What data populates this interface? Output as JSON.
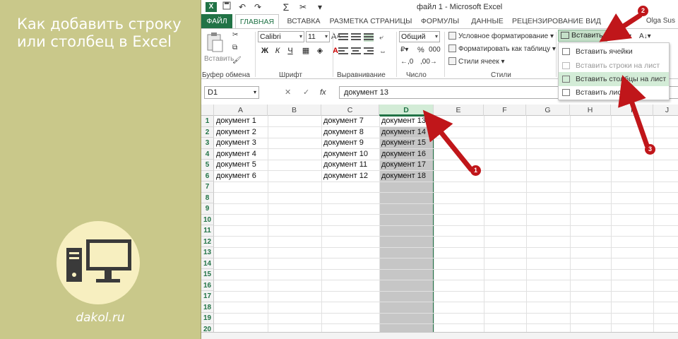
{
  "left_panel": {
    "title": "Как добавить строку или столбец в Excel",
    "site": "dakol.ru"
  },
  "window": {
    "title": "файл 1 - Microsoft Excel",
    "app_icon_letter": "X",
    "user": "Olga Sus"
  },
  "ribbon_tabs": [
    "ФАЙЛ",
    "ГЛАВНАЯ",
    "ВСТАВКА",
    "РАЗМЕТКА СТРАНИЦЫ",
    "ФОРМУЛЫ",
    "ДАННЫЕ",
    "РЕЦЕНЗИРОВАНИЕ",
    "ВИД"
  ],
  "ribbon": {
    "paste_label": "Вставить",
    "clipboard_label": "Буфер обмена",
    "font_name": "Calibri",
    "font_size": "11",
    "font_label": "Шрифт",
    "bold": "Ж",
    "italic": "К",
    "underline": "Ч",
    "alignment_label": "Выравнивание",
    "number_format": "Общий",
    "percent": "%",
    "thousands": "000",
    "number_label": "Число",
    "cond_format": "Условное форматирование",
    "format_table": "Форматировать как таблицу",
    "cell_styles": "Стили ячеек",
    "styles_label": "Стили",
    "insert_button": "Вставить",
    "sum_symbol": "Σ"
  },
  "insert_menu": [
    {
      "label": "Вставить ячейки",
      "enabled": true,
      "highlighted": false
    },
    {
      "label": "Вставить строки на лист",
      "enabled": false,
      "highlighted": false
    },
    {
      "label": "Вставить столбцы на лист",
      "enabled": true,
      "highlighted": true
    },
    {
      "label": "Вставить лист",
      "enabled": true,
      "highlighted": false
    }
  ],
  "formula_bar": {
    "name_box": "D1",
    "fx": "fx",
    "value": "документ 13"
  },
  "columns": [
    "A",
    "B",
    "C",
    "D",
    "E",
    "F",
    "G",
    "H",
    "I",
    "J"
  ],
  "selected_column": "D",
  "rows": [
    "1",
    "2",
    "3",
    "4",
    "5",
    "6",
    "7",
    "8",
    "9",
    "10",
    "11",
    "12",
    "13",
    "14",
    "15",
    "16",
    "17",
    "18",
    "19",
    "20"
  ],
  "cells": {
    "A": [
      "документ 1",
      "документ 2",
      "документ 3",
      "документ 4",
      "документ 5",
      "документ 6"
    ],
    "C": [
      "документ 7",
      "документ 8",
      "документ 9",
      "документ 10",
      "документ 11",
      "документ 12"
    ],
    "D": [
      "документ 13",
      "документ 14",
      "документ 15",
      "документ 16",
      "документ 17",
      "документ 18"
    ]
  },
  "annotations": [
    "1",
    "2",
    "3"
  ],
  "colors": {
    "excel_green": "#217346",
    "panel_bg": "#c9c88a",
    "arrow_red": "#c0161a",
    "highlight": "#d3ecd7"
  }
}
